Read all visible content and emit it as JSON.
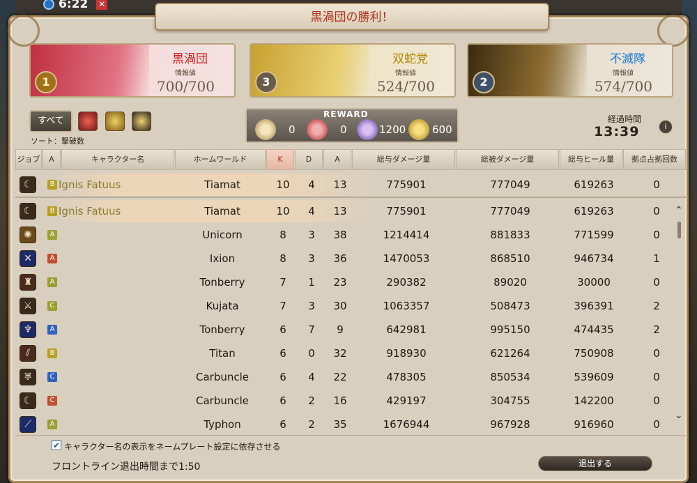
{
  "hud": {
    "clock": "6:22"
  },
  "window": {
    "title": "黒渦団の勝利！"
  },
  "factions": [
    {
      "name": "黒渦団",
      "info_label": "情報値",
      "info_value": "700/700",
      "rank": "1"
    },
    {
      "name": "双蛇党",
      "info_label": "情報値",
      "info_value": "524/700",
      "rank": "3"
    },
    {
      "name": "不滅隊",
      "info_label": "情報値",
      "info_value": "574/700",
      "rank": "2"
    }
  ],
  "filters": {
    "all_label": "すべて",
    "sort_label": "ソート：撃破数"
  },
  "reward": {
    "title": "REWARD",
    "items": [
      {
        "icon": "pvp-exp-icon",
        "value": "0"
      },
      {
        "icon": "wolf-mark-icon",
        "value": "0"
      },
      {
        "icon": "series-exp-icon",
        "value": "1200"
      },
      {
        "icon": "gil-icon",
        "value": "600"
      }
    ]
  },
  "elapsed": {
    "label": "経過時間",
    "time": "13:39"
  },
  "columns": [
    "ジョブ",
    "A",
    "キャラクター名",
    "ホームワールド",
    "K",
    "D",
    "A",
    "総与ダメージ量",
    "総被ダメージ量",
    "総与ヒール量",
    "拠点占拠回数"
  ],
  "self_row": {
    "group": "B",
    "name": "Ignis Fatuus",
    "world": "Tiamat",
    "k": "10",
    "d": "4",
    "a": "13",
    "dmg": "775901",
    "taken": "777049",
    "heal": "619263",
    "cap": "0"
  },
  "rows": [
    {
      "group": "B",
      "name": "Ignis Fatuus",
      "world": "Tiamat",
      "k": "10",
      "d": "4",
      "a": "13",
      "dmg": "775901",
      "taken": "777049",
      "heal": "619263",
      "cap": "0"
    },
    {
      "group": "A",
      "name": "",
      "world": "Unicorn",
      "k": "8",
      "d": "3",
      "a": "38",
      "dmg": "1214414",
      "taken": "881833",
      "heal": "771599",
      "cap": "0"
    },
    {
      "group": "A",
      "name": "",
      "world": "Ixion",
      "k": "8",
      "d": "3",
      "a": "36",
      "dmg": "1470053",
      "taken": "868510",
      "heal": "946734",
      "cap": "1"
    },
    {
      "group": "A",
      "name": "",
      "world": "Tonberry",
      "k": "7",
      "d": "1",
      "a": "23",
      "dmg": "290382",
      "taken": "89020",
      "heal": "30000",
      "cap": "0"
    },
    {
      "group": "C",
      "name": "",
      "world": "Kujata",
      "k": "7",
      "d": "3",
      "a": "30",
      "dmg": "1063357",
      "taken": "508473",
      "heal": "396391",
      "cap": "2"
    },
    {
      "group": "A",
      "name": "",
      "world": "Tonberry",
      "k": "6",
      "d": "7",
      "a": "9",
      "dmg": "642981",
      "taken": "995150",
      "heal": "474435",
      "cap": "2"
    },
    {
      "group": "B",
      "name": "",
      "world": "Titan",
      "k": "6",
      "d": "0",
      "a": "32",
      "dmg": "918930",
      "taken": "621264",
      "heal": "750908",
      "cap": "0"
    },
    {
      "group": "C",
      "name": "",
      "world": "Carbuncle",
      "k": "6",
      "d": "4",
      "a": "22",
      "dmg": "478305",
      "taken": "850534",
      "heal": "539609",
      "cap": "0"
    },
    {
      "group": "C",
      "name": "",
      "world": "Carbuncle",
      "k": "6",
      "d": "2",
      "a": "16",
      "dmg": "429197",
      "taken": "304755",
      "heal": "142200",
      "cap": "0"
    },
    {
      "group": "A",
      "name": "",
      "world": "Typhon",
      "k": "6",
      "d": "2",
      "a": "35",
      "dmg": "1676944",
      "taken": "967928",
      "heal": "916960",
      "cap": "0"
    }
  ],
  "footer": {
    "checkbox_label": "キャラクター名の表示をネームプレート設定に依存させる",
    "leave_timer": "フロントライン退出時間まで1:50",
    "leave_button": "退出する"
  }
}
